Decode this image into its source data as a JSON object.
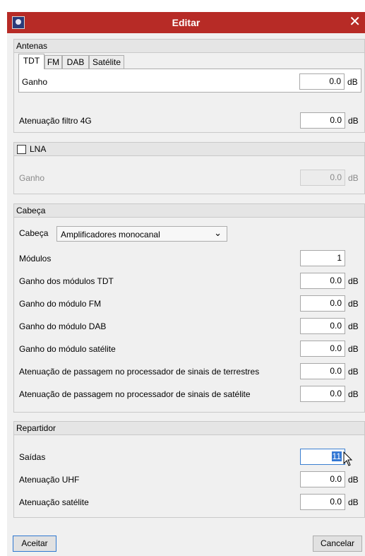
{
  "window": {
    "title": "Editar",
    "close_glyph": "✕",
    "icon": "app-icon"
  },
  "antenas": {
    "header": "Antenas",
    "tabs": [
      "TDT",
      "FM",
      "DAB",
      "Satélite"
    ],
    "ganho_label": "Ganho",
    "ganho_value": "0.0",
    "ganho_unit": "dB",
    "atenuacao_label": "Atenuação filtro 4G",
    "atenuacao_value": "0.0",
    "atenuacao_unit": "dB"
  },
  "lna": {
    "checkbox_label": "LNA",
    "checked": false,
    "ganho_label": "Ganho",
    "ganho_value": "0.0",
    "ganho_unit": "dB"
  },
  "cabeca": {
    "header": "Cabeça",
    "combo_label": "Cabeça",
    "combo_value": "Amplificadores monocanal",
    "modulos_label": "Módulos",
    "modulos_value": "1",
    "rows": [
      {
        "label": "Ganho dos módulos TDT",
        "value": "0.0",
        "unit": "dB"
      },
      {
        "label": "Ganho do módulo FM",
        "value": "0.0",
        "unit": "dB"
      },
      {
        "label": "Ganho do módulo DAB",
        "value": "0.0",
        "unit": "dB"
      },
      {
        "label": "Ganho do módulo satélite",
        "value": "0.0",
        "unit": "dB"
      },
      {
        "label": "Atenuação de passagem no processador de sinais de terrestres",
        "value": "0.0",
        "unit": "dB"
      },
      {
        "label": "Atenuação de passagem no processador de sinais de satélite",
        "value": "0.0",
        "unit": "dB"
      }
    ]
  },
  "repartidor": {
    "header": "Repartidor",
    "saidas_label": "Saídas",
    "saidas_value": "11",
    "uhf_label": "Atenuação UHF",
    "uhf_value": "0.0",
    "uhf_unit": "dB",
    "sat_label": "Atenuação satélite",
    "sat_value": "0.0",
    "sat_unit": "dB"
  },
  "buttons": {
    "ok": "Aceitar",
    "cancel": "Cancelar"
  },
  "colors": {
    "titlebar": "#b72b26",
    "panel": "#f0f0f0",
    "selection": "#3478d4"
  }
}
